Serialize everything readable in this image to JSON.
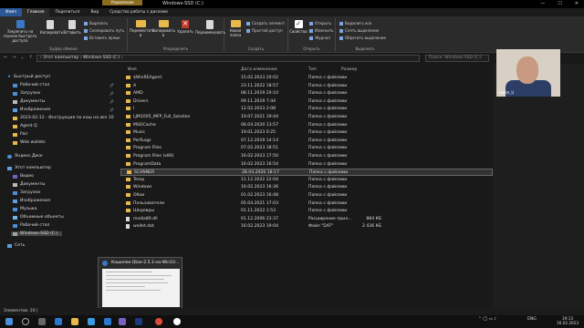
{
  "window": {
    "context_tab": "Управление",
    "title": "Windows-SSD (C:)",
    "controls": [
      "—",
      "☐",
      "✕"
    ]
  },
  "menu_tabs": [
    "Файл",
    "Главная",
    "Поделиться",
    "Вид",
    "Средства работы с дисками"
  ],
  "ribbon": {
    "groups": {
      "clipboard": "Буфер обмена",
      "organize": "Упорядочить",
      "create": "Создать",
      "open": "Открыть",
      "select": "Выделить"
    },
    "pin_quick": "Закрепить на панели быстрого доступа",
    "copy": "Копировать",
    "paste": "Вставить",
    "cut": "Вырезать",
    "copy_path": "Скопировать путь",
    "paste_shortcut": "Вставить ярлык",
    "move_to": "Переместить в",
    "copy_to": "Копировать в",
    "delete": "Удалить",
    "rename": "Переименовать",
    "new_folder": "Новая папка",
    "new_item": "Создать элемент",
    "easy_access": "Простой доступ",
    "properties": "Свойства",
    "open": "Открыть",
    "edit": "Изменить",
    "history": "Журнал",
    "select_all": "Выделить все",
    "select_none": "Снять выделение",
    "invert_selection": "Обратить выделение"
  },
  "address": {
    "path": "›  Этот компьютер  ›  Windows-SSD (C:)  ›",
    "search_placeholder": "Поиск: Windows-SSD (C:)"
  },
  "sidebar": {
    "quick_access": "Быстрый доступ",
    "items": [
      {
        "label": "Рабочий стол",
        "pinned": true
      },
      {
        "label": "Загрузки",
        "pinned": true
      },
      {
        "label": "Документы",
        "pinned": true
      },
      {
        "label": "Изображения",
        "pinned": true
      },
      {
        "label": "2023-02-12 - Инструкция по кош на win 10",
        "pinned": false
      },
      {
        "label": "Agent Q",
        "pinned": false
      },
      {
        "label": "Pair",
        "pinned": false
      },
      {
        "label": "Web wallets",
        "pinned": false
      }
    ],
    "yandex_disk": "Яндекс.Диск",
    "this_pc": "Этот компьютер",
    "pc_items": [
      "Видео",
      "Документы",
      "Загрузки",
      "Изображения",
      "Музыка",
      "Объемные объекты",
      "Рабочий стол",
      "Windows-SSD (C:)"
    ],
    "network": "Сеть"
  },
  "columns": {
    "name": "Имя",
    "date": "Дата изменения",
    "type": "Тип",
    "size": "Размер"
  },
  "files": [
    {
      "name": "$WinREAgent",
      "date": "15.02.2023 20:02",
      "type": "Папка с файлами",
      "size": "",
      "folder": true
    },
    {
      "name": "A",
      "date": "23.11.2022 18:57",
      "type": "Папка с файлами",
      "size": "",
      "folder": true
    },
    {
      "name": "AMD",
      "date": "08.11.2019 20:10",
      "type": "Папка с файлами",
      "size": "",
      "folder": true
    },
    {
      "name": "Drivers",
      "date": "09.11.2019 7:44",
      "type": "Папка с файлами",
      "size": "",
      "folder": true
    },
    {
      "name": "I",
      "date": "12.02.2023 2:08",
      "type": "Папка с файлами",
      "size": "",
      "folder": true
    },
    {
      "name": "LJM1005_MFP_Full_Solution",
      "date": "19.07.2021 19:44",
      "type": "Папка с файлами",
      "size": "",
      "folder": true
    },
    {
      "name": "MSOCache",
      "date": "06.04.2020 13:57",
      "type": "Папка с файлами",
      "size": "",
      "folder": true
    },
    {
      "name": "Music",
      "date": "19.01.2023 0:25",
      "type": "Папка с файлами",
      "size": "",
      "folder": true
    },
    {
      "name": "PerfLogs",
      "date": "07.12.2019 14:14",
      "type": "Папка с файлами",
      "size": "",
      "folder": true
    },
    {
      "name": "Program Files",
      "date": "07.02.2023 18:51",
      "type": "Папка с файлами",
      "size": "",
      "folder": true
    },
    {
      "name": "Program Files (x86)",
      "date": "16.02.2023 17:50",
      "type": "Папка с файлами",
      "size": "",
      "folder": true
    },
    {
      "name": "ProgramData",
      "date": "16.02.2023 16:54",
      "type": "Папка с файлами",
      "size": "",
      "folder": true
    },
    {
      "name": "SCANNER",
      "date": "28.04.2020 18:17",
      "type": "Папка с файлами",
      "size": "",
      "folder": true
    },
    {
      "name": "Temp",
      "date": "11.12.2022 22:04",
      "type": "Папка с файлами",
      "size": "",
      "folder": true
    },
    {
      "name": "Windows",
      "date": "16.02.2023 16:36",
      "type": "Папка с файлами",
      "size": "",
      "folder": true
    },
    {
      "name": "Обои",
      "date": "01.02.2023 16:48",
      "type": "Папка с файлами",
      "size": "",
      "folder": true
    },
    {
      "name": "Пользователи",
      "date": "05.04.2021 17:03",
      "type": "Папка с файлами",
      "size": "",
      "folder": true
    },
    {
      "name": "Шедевры",
      "date": "01.11.2022 1:53",
      "type": "Папка с файлами",
      "size": "",
      "folder": true
    },
    {
      "name": "msdia80.dll",
      "date": "01.12.2006 23:37",
      "type": "Расширение прил...",
      "size": "884 КБ",
      "folder": false
    },
    {
      "name": "wallet.dat",
      "date": "16.02.2023 19:04",
      "type": "Файл \"DAT\"",
      "size": "2 436 КБ",
      "folder": false
    }
  ],
  "selected_row": 12,
  "webcam_label": "vadim_U",
  "thumbnail": {
    "title": "Кошелек-Qtae-2.5.1-на-Win10..."
  },
  "status": {
    "items": "Элементов: 20  |"
  },
  "taskbar": {
    "lang": "ENG",
    "time": "19:13",
    "date": "16.02.2023"
  }
}
